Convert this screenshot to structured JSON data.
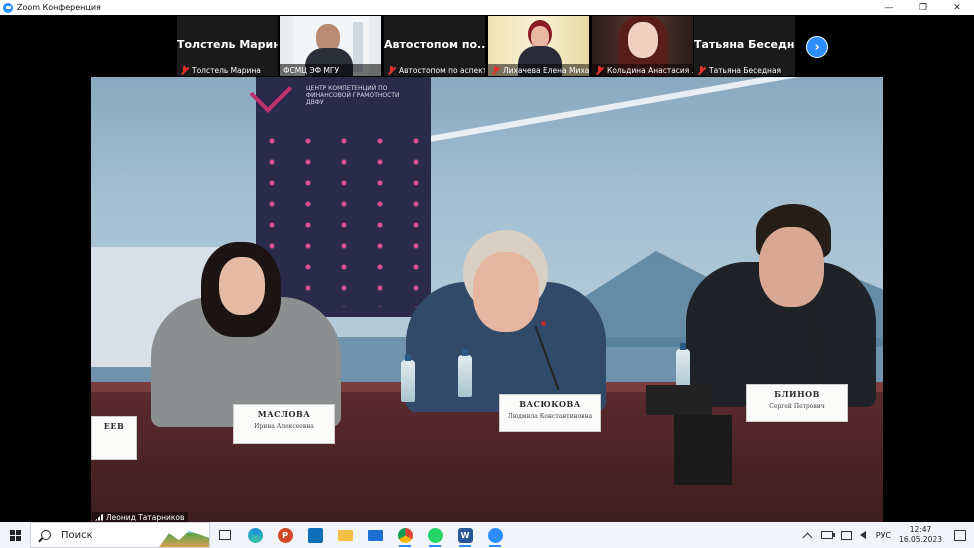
{
  "window": {
    "title": "Zoom Конференция",
    "controls": [
      "—",
      "❐",
      "✕"
    ]
  },
  "participants": [
    {
      "name": "Толстель Марина",
      "caption": "Толстель Марина",
      "video": false,
      "muted": true
    },
    {
      "name": "",
      "caption": "ФСМЦ ЭФ МГУ",
      "video": true,
      "muted": false
    },
    {
      "name": "Автостопом по...",
      "caption": "Автостопом по аспект...",
      "video": false,
      "muted": true
    },
    {
      "name": "",
      "caption": "Лихачева Елена Миха...",
      "video": true,
      "muted": true
    },
    {
      "name": "",
      "caption": "Кольдина Анастасия ...",
      "video": true,
      "muted": true
    },
    {
      "name": "Татьяна Беседн...",
      "caption": "Татьяна Беседная",
      "video": false,
      "muted": true
    }
  ],
  "main_video": {
    "speaker": "Леонид Татарников",
    "banner_text": "ЦЕНТР КОМПЕТЕНЦИЙ ПО ФИНАНСОВОЙ ГРАМОТНОСТИ ДВФУ",
    "nameplates": [
      {
        "surname": "ЕЕВ",
        "first": ""
      },
      {
        "surname": "МАСЛОВА",
        "first": "Ирина Алексеевна"
      },
      {
        "surname": "ВАСЮКОВА",
        "first": "Людмила Константиновна"
      },
      {
        "surname": "БЛИНОВ",
        "first": "Сергей Петрович"
      }
    ]
  },
  "taskbar": {
    "search_placeholder": "Поиск",
    "apps": [
      "task-view",
      "edge",
      "powerpoint",
      "store",
      "explorer",
      "mail",
      "chrome",
      "whatsapp",
      "word",
      "zoom"
    ]
  },
  "tray": {
    "language": "РУС",
    "time": "12:47",
    "date": "16.05.2023"
  },
  "colors": {
    "accent": "#2d8cff",
    "muted_red": "#e5322d"
  }
}
